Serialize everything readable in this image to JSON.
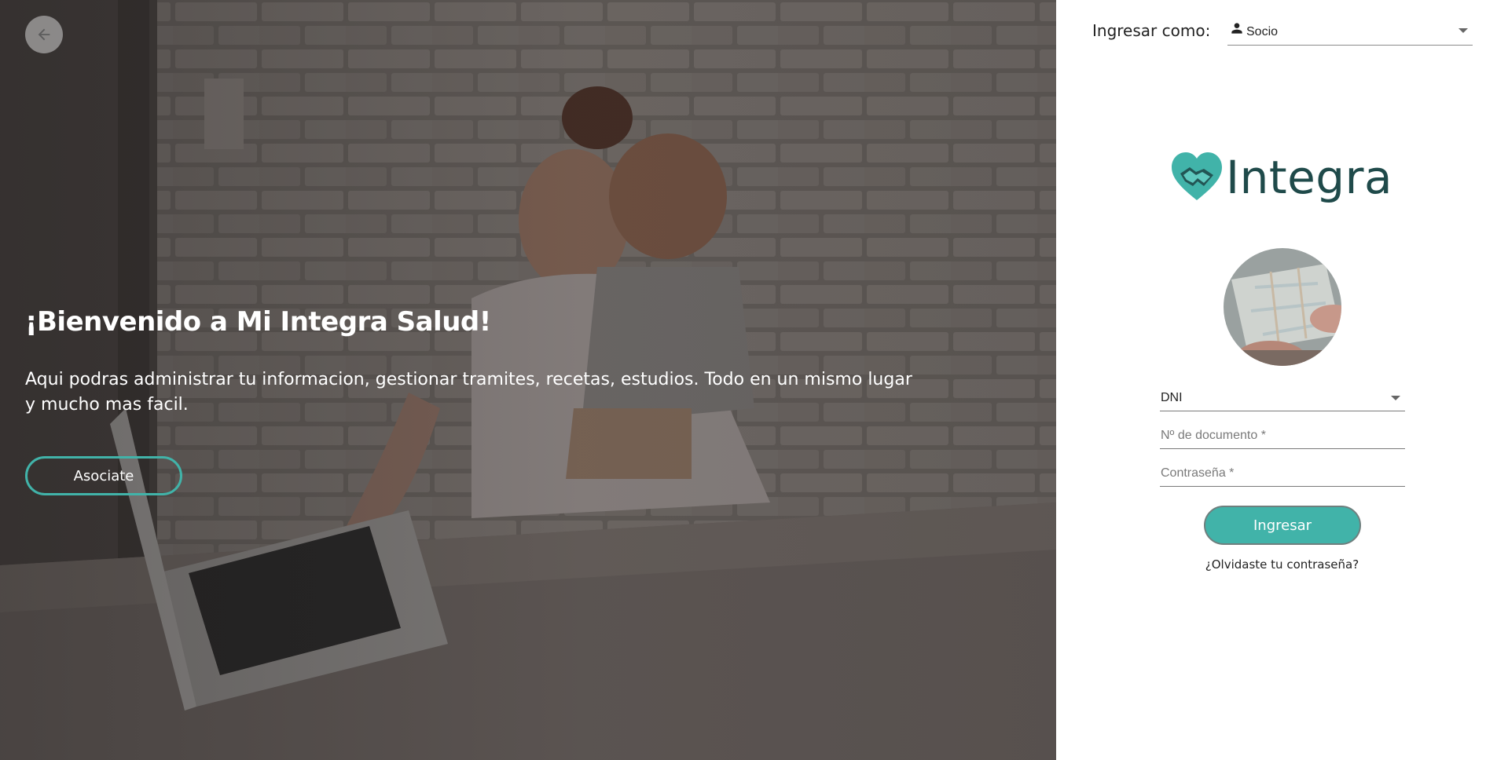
{
  "hero": {
    "title": "¡Bienvenido a Mi Integra Salud!",
    "text": "Aqui podras administrar tu informacion, gestionar tramites, recetas, estudios. Todo en un mismo lugar y mucho mas facil.",
    "join_button": "Asociate",
    "back_icon": "arrow-left-icon"
  },
  "login": {
    "role_label": "Ingresar como:",
    "role_value": "Socio",
    "role_icon": "person-icon",
    "brand": "Integra",
    "brand_color": "#1f4a4a",
    "accent_color": "#41b3a9",
    "doc_type_value": "DNI",
    "doc_number_placeholder": "Nº de documento *",
    "password_placeholder": "Contraseña *",
    "submit_label": "Ingresar",
    "forgot_link": "¿Olvidaste tu contraseña?"
  }
}
